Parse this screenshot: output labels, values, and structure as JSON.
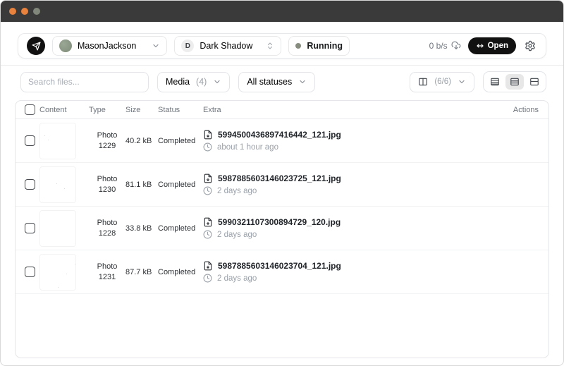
{
  "window": {
    "titlebar_dots": [
      "#e8823c",
      "#e8823c",
      "#81877a"
    ]
  },
  "header": {
    "account_name": "MasonJackson",
    "bot_initial": "D",
    "bot_name": "Dark Shadow",
    "status_label": "Running",
    "speed_label": "0 b/s",
    "open_label": "Open"
  },
  "toolbar": {
    "search_placeholder": "Search files...",
    "media_label": "Media",
    "media_count": "(4)",
    "status_filter_label": "All statuses",
    "columns_label": "(6/6)"
  },
  "table": {
    "headers": [
      "Content",
      "Type",
      "Size",
      "Status",
      "Extra",
      "Actions"
    ],
    "rows": [
      {
        "type_name": "Photo",
        "type_id": "1229",
        "size": "40.2 kB",
        "status": "Completed",
        "filename": "5994500436897416442_121.jpg",
        "time": "about 1 hour ago"
      },
      {
        "type_name": "Photo",
        "type_id": "1230",
        "size": "81.1 kB",
        "status": "Completed",
        "filename": "5987885603146023725_121.jpg",
        "time": "2 days ago"
      },
      {
        "type_name": "Photo",
        "type_id": "1228",
        "size": "33.8 kB",
        "status": "Completed",
        "filename": "5990321107300894729_120.jpg",
        "time": "2 days ago"
      },
      {
        "type_name": "Photo",
        "type_id": "1231",
        "size": "87.7 kB",
        "status": "Completed",
        "filename": "5987885603146023704_121.jpg",
        "time": "2 days ago"
      }
    ]
  },
  "icons": {
    "brand": "telegram-send-icon",
    "account_chevron": "chevron-down-icon",
    "bot_chevrons": "chevrons-up-down-icon",
    "speed": "cloud-download-icon",
    "open": "left-right-arrow-icon",
    "settings": "gear-icon",
    "columns": "columns-icon",
    "density": [
      "rows-compact-icon",
      "rows-medium-icon",
      "rows-relaxed-icon"
    ],
    "file": "file-down-icon",
    "time": "clock-icon"
  },
  "colors": {
    "titlebar": "#3a3a3a",
    "border": "#e5e6e9",
    "muted_text": "#9aa1a9",
    "primary_text": "#1a1c1e",
    "accent_button": "#111111",
    "status_dot": "#868d7f",
    "avatar_green": "#8e9b88",
    "selected_segment": "#e7e7e8"
  }
}
